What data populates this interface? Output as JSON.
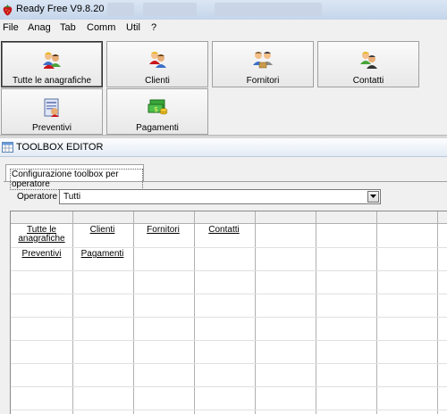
{
  "window": {
    "title": "Ready Free V9.8.20"
  },
  "menu": [
    "File",
    "Anag",
    "Tab",
    "Comm",
    "Util",
    "?"
  ],
  "toolbar": {
    "tiles": [
      {
        "label": "Tutte le anagrafiche",
        "icon": "people-group-icon",
        "active": true
      },
      {
        "label": "Clienti",
        "icon": "clients-icon",
        "active": false
      },
      {
        "label": "Fornitori",
        "icon": "suppliers-icon",
        "active": false
      },
      {
        "label": "Contatti",
        "icon": "contacts-icon",
        "active": false
      },
      {
        "label": "Preventivi",
        "icon": "quote-document-icon",
        "active": false
      },
      {
        "label": "Pagamenti",
        "icon": "money-icon",
        "active": false
      }
    ]
  },
  "editor": {
    "title": "TOOLBOX EDITOR",
    "tab": "Configurazione toolbox per operatore",
    "operator_label": "Operatore :",
    "operator_value": "Tutti",
    "grid": {
      "rows": [
        [
          "Tutte le anagrafiche",
          "Clienti",
          "Fornitori",
          "Contatti",
          "",
          "",
          "",
          ""
        ],
        [
          "Preventivi",
          "Pagamenti",
          "",
          "",
          "",
          "",
          "",
          ""
        ]
      ]
    }
  }
}
